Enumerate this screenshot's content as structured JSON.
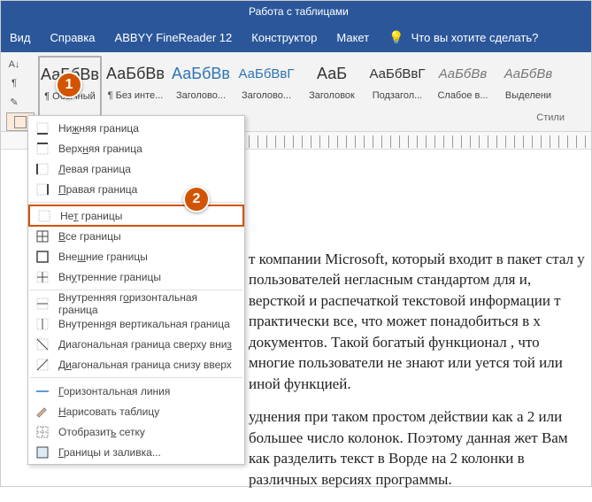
{
  "title_bar": {
    "context_tab": "Работа с таблицами"
  },
  "menu": {
    "view": "Вид",
    "help": "Справка",
    "abbyy": "ABBYY FineReader 12",
    "design": "Конструктор",
    "layout": "Макет",
    "tellme": "Что вы хотите сделать?"
  },
  "ribbon": {
    "styles_label": "Стили",
    "styles": [
      {
        "sample": "АаБбВв",
        "name": "¶ Обычный",
        "cls": ""
      },
      {
        "sample": "АаБбВв",
        "name": "¶ Без инте...",
        "cls": ""
      },
      {
        "sample": "АаБбВв",
        "name": "Заголово...",
        "cls": "blue"
      },
      {
        "sample": "АаБбВвГ",
        "name": "Заголово...",
        "cls": "blue small"
      },
      {
        "sample": "АаБ",
        "name": "Заголовок",
        "cls": ""
      },
      {
        "sample": "АаБбВвГ",
        "name": "Подзагол...",
        "cls": "small"
      },
      {
        "sample": "АаБбВв",
        "name": "Слабое в...",
        "cls": "italic small"
      },
      {
        "sample": "АаБбВв",
        "name": "Выделени",
        "cls": "italic small"
      }
    ]
  },
  "dropdown": {
    "items": [
      {
        "label_pre": "Ни",
        "accel": "ж",
        "label_post": "няя граница",
        "icon": "border-bottom"
      },
      {
        "label_pre": "Верх",
        "accel": "н",
        "label_post": "яя граница",
        "icon": "border-top"
      },
      {
        "label_pre": "",
        "accel": "Л",
        "label_post": "евая граница",
        "icon": "border-left"
      },
      {
        "label_pre": "",
        "accel": "П",
        "label_post": "равая граница",
        "icon": "border-right"
      },
      {
        "sep": true
      },
      {
        "label_pre": "Не",
        "accel": "т",
        "label_post": " границы",
        "icon": "border-none",
        "selected": true
      },
      {
        "label_pre": "",
        "accel": "В",
        "label_post": "се границы",
        "icon": "border-all"
      },
      {
        "label_pre": "Вне",
        "accel": "ш",
        "label_post": "ние границы",
        "icon": "border-outer"
      },
      {
        "label_pre": "Вн",
        "accel": "у",
        "label_post": "тренние границы",
        "icon": "border-inner"
      },
      {
        "sep": true
      },
      {
        "label_pre": "Внутренняя г",
        "accel": "о",
        "label_post": "ризонтальная граница",
        "icon": "border-h"
      },
      {
        "label_pre": "Внутренн",
        "accel": "я",
        "label_post": "я вертикальная граница",
        "icon": "border-v"
      },
      {
        "label_pre": "Диагональная граница сверху вни",
        "accel": "з",
        "label_post": "",
        "icon": "diag-down"
      },
      {
        "label_pre": "Д",
        "accel": "и",
        "label_post": "агональная граница снизу вверх",
        "icon": "diag-up"
      },
      {
        "sep": true
      },
      {
        "label_pre": "",
        "accel": "Г",
        "label_post": "оризонтальная линия",
        "icon": "hline"
      },
      {
        "label_pre": "",
        "accel": "Н",
        "label_post": "арисовать таблицу",
        "icon": "draw"
      },
      {
        "label_pre": "Отобразит",
        "accel": "ь",
        "label_post": " сетку",
        "icon": "grid"
      },
      {
        "label_pre": "",
        "accel": "Г",
        "label_post": "раницы и заливка...",
        "icon": "borders-shading"
      }
    ]
  },
  "markers": {
    "one": "1",
    "two": "2"
  },
  "document": {
    "p1": "т компании Microsoft, который входит в пакет стал у пользователей негласным стандартом для и, версткой и распечаткой текстовой информации т практически все, что может понадобиться в х документов. Такой богатый функционал , что многие пользователи не знают или уется той или иной функцией.",
    "p2": "уднения при таком простом действии как а 2 или большее число колонок. Поэтому данная жет Вам как разделить текст в Ворде на 2 колонки в различных версиях программы."
  }
}
